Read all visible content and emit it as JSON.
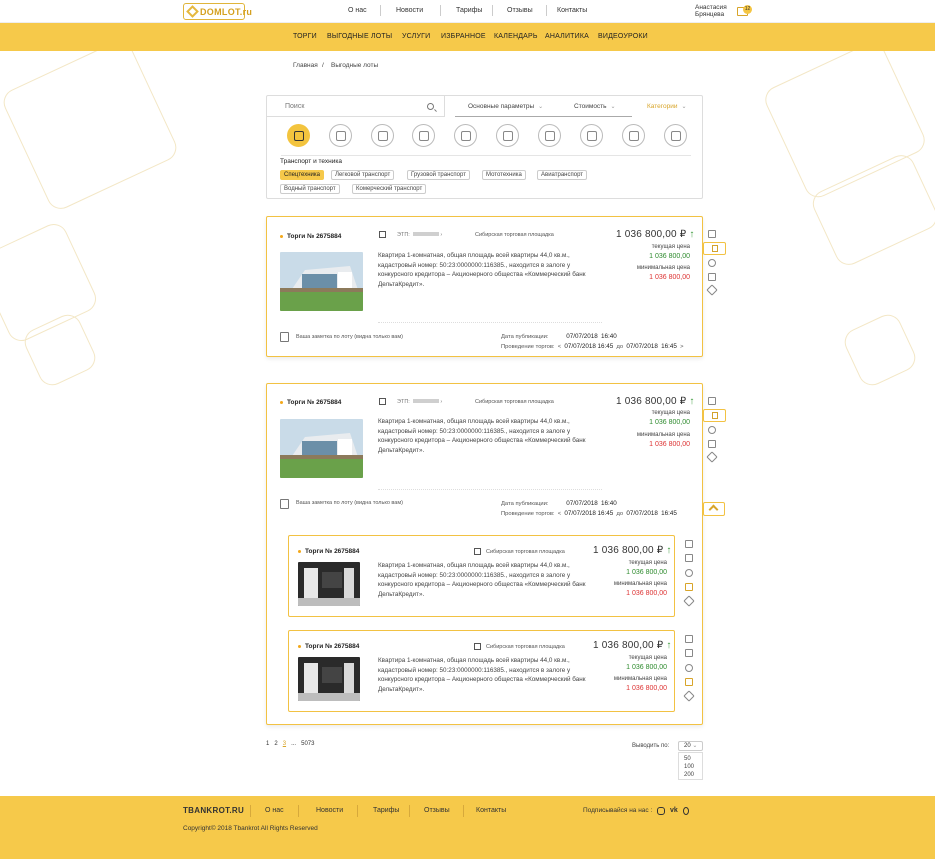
{
  "header": {
    "logo": "DOMLOT.ru",
    "nav": [
      "О нас",
      "Новости",
      "Тарифы",
      "Отзывы",
      "Контакты"
    ],
    "user_first": "Анастасия",
    "user_last": "Брянцева",
    "cart_count": "12"
  },
  "mainnav": [
    "ТОРГИ",
    "ВЫГОДНЫЕ  ЛОТЫ",
    "УСЛУГИ",
    "ИЗБРАННОЕ",
    "КАЛЕНДАРЬ",
    "АНАЛИТИКА",
    "ВИДЕОУРОКИ"
  ],
  "breadcrumb": {
    "home": "Главная",
    "sep": "/",
    "current": "Выгодные лоты"
  },
  "filter": {
    "search_placeholder": "Поиск",
    "params": "Основные параметры",
    "cost": "Стоимость",
    "categories": "Категории",
    "chev": "⌄",
    "section_title": "Транспорт и техника",
    "tags_row1": [
      "Спецтехника",
      "Легковой транспорт",
      "Грузовой транспорт",
      "Мототехника",
      "Авиатранспорт"
    ],
    "tags_row2": [
      "Водный транспорт",
      "Комерческий транспорт"
    ]
  },
  "lot": {
    "number": "Торги № 2675884",
    "etp": "ЭТП:",
    "etp_arrow": "›",
    "platform": "Сибирская торговая площадка",
    "desc": "Квартира 1-комнатная, общая площадь всей квартиры 44,0 кв.м., кадастровый номер: 50:23:0000000:116385., находится в залоге у конкурсного кредитора – Акционерного общества «Коммерческий банк ДельтаКредит».",
    "price": "1 036 800,00 ₽",
    "price_arrow": "↑",
    "current_label": "текущая цена",
    "current": "1 036 800,00",
    "min_label": "минимальная цена",
    "min": "1 036 800,00",
    "note": "Ваша заметка по лоту (видна только вам)",
    "pub_label": "Дата публикации:",
    "pub_date": "07/07/2018",
    "pub_time": "16:40",
    "held_label": "Проведение торгов:",
    "held_lt": "<",
    "held_from_date": "07/07/2018",
    "held_from_time": "16:45",
    "held_to": "до",
    "held_to_date": "07/07/2018",
    "held_to_time": "16:45",
    "held_gt": ">"
  },
  "pagination": {
    "p1": "1",
    "p2": "2",
    "p3": "3",
    "dots": "...",
    "last": "5073"
  },
  "perpage": {
    "label": "Выводить по:",
    "value": "20",
    "options": [
      "50",
      "100",
      "200"
    ]
  },
  "footer": {
    "logo": "TBANKROT.RU",
    "nav": [
      "О нас",
      "Новости",
      "Тарифы",
      "Отзывы",
      "Контакты"
    ],
    "subscribe": "Подписывайся на нас :",
    "copyright": "Copyright© 2018 Tbankrot All Rights Reserved"
  }
}
